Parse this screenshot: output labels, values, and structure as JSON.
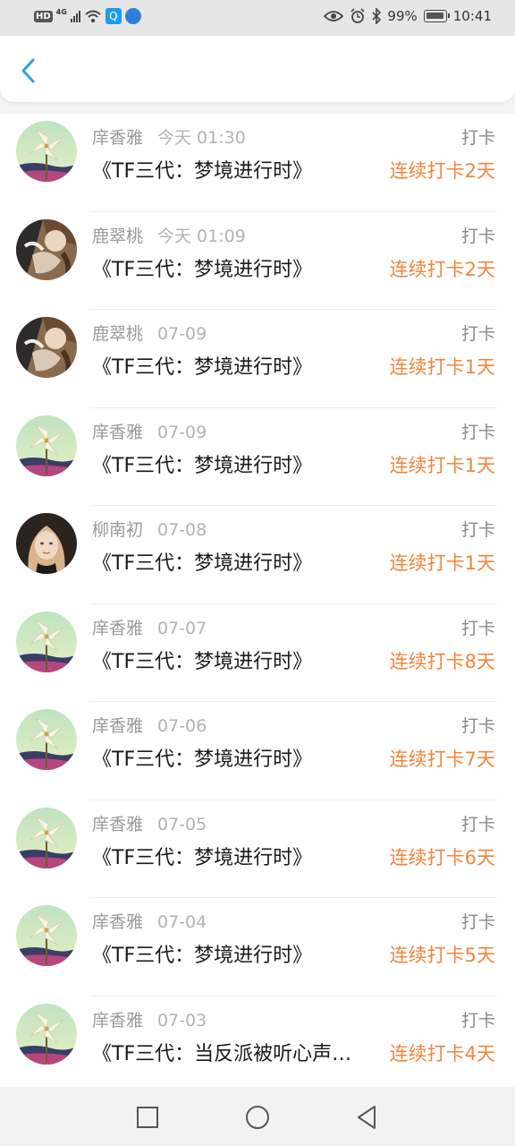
{
  "status_bar": {
    "hd": "HD",
    "network": "4G",
    "battery_percent": "99%",
    "time": "10:41"
  },
  "header": {
    "back_icon": "chevron-left-icon"
  },
  "list": [
    {
      "user": "庠香雅",
      "time": "今天 01:30",
      "title": "《TF三代：梦境进行时》",
      "tag": "打卡",
      "streak": "连续打卡2天",
      "avatar": "pinwheel"
    },
    {
      "user": "鹿翠桃",
      "time": "今天 01:09",
      "title": "《TF三代：梦境进行时》",
      "tag": "打卡",
      "streak": "连续打卡2天",
      "avatar": "artwork"
    },
    {
      "user": "鹿翠桃",
      "time": "07-09",
      "title": "《TF三代：梦境进行时》",
      "tag": "打卡",
      "streak": "连续打卡1天",
      "avatar": "artwork"
    },
    {
      "user": "庠香雅",
      "time": "07-09",
      "title": "《TF三代：梦境进行时》",
      "tag": "打卡",
      "streak": "连续打卡1天",
      "avatar": "pinwheel"
    },
    {
      "user": "柳南初",
      "time": "07-08",
      "title": "《TF三代：梦境进行时》",
      "tag": "打卡",
      "streak": "连续打卡1天",
      "avatar": "portrait"
    },
    {
      "user": "庠香雅",
      "time": "07-07",
      "title": "《TF三代：梦境进行时》",
      "tag": "打卡",
      "streak": "连续打卡8天",
      "avatar": "pinwheel"
    },
    {
      "user": "庠香雅",
      "time": "07-06",
      "title": "《TF三代：梦境进行时》",
      "tag": "打卡",
      "streak": "连续打卡7天",
      "avatar": "pinwheel"
    },
    {
      "user": "庠香雅",
      "time": "07-05",
      "title": "《TF三代：梦境进行时》",
      "tag": "打卡",
      "streak": "连续打卡6天",
      "avatar": "pinwheel"
    },
    {
      "user": "庠香雅",
      "time": "07-04",
      "title": "《TF三代：梦境进行时》",
      "tag": "打卡",
      "streak": "连续打卡5天",
      "avatar": "pinwheel"
    },
    {
      "user": "庠香雅",
      "time": "07-03",
      "title": "《TF三代：当反派被听心声…",
      "tag": "打卡",
      "streak": "连续打卡4天",
      "avatar": "pinwheel"
    }
  ],
  "nav_bar": {
    "recent_icon": "square-icon",
    "home_icon": "circle-icon",
    "back_icon": "triangle-back-icon"
  },
  "colors": {
    "accent": "#f0863c",
    "back_arrow": "#2aa3e0"
  }
}
